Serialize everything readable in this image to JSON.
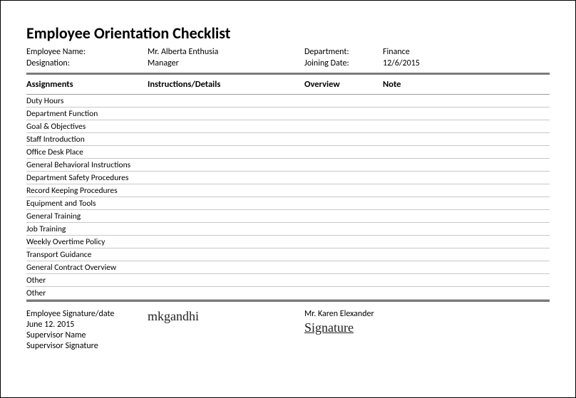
{
  "title": "Employee Orientation Checklist",
  "meta": {
    "employee_name_label": "Employee Name:",
    "employee_name_value": "Mr. Alberta Enthusia",
    "designation_label": "Designation:",
    "designation_value": "Manager",
    "department_label": "Department:",
    "department_value": "Finance",
    "joining_label": "Joining Date:",
    "joining_value": "12/6/2015"
  },
  "columns": {
    "c1": "Assignments",
    "c2": "Instructions/Details",
    "c3": "Overview",
    "c4": "Note"
  },
  "rows": [
    {
      "c1": "Duty Hours",
      "c2": "",
      "c3": "",
      "c4": ""
    },
    {
      "c1": "Department Function",
      "c2": "",
      "c3": "",
      "c4": ""
    },
    {
      "c1": "Goal & Objectives",
      "c2": "",
      "c3": "",
      "c4": ""
    },
    {
      "c1": "Staff Introduction",
      "c2": "",
      "c3": "",
      "c4": ""
    },
    {
      "c1": "Office Desk Place",
      "c2": "",
      "c3": "",
      "c4": ""
    },
    {
      "c1": "General Behavioral Instructions",
      "c2": "",
      "c3": "",
      "c4": ""
    },
    {
      "c1": "Department Safety Procedures",
      "c2": "",
      "c3": "",
      "c4": ""
    },
    {
      "c1": "Record Keeping Procedures",
      "c2": "",
      "c3": "",
      "c4": ""
    },
    {
      "c1": "Equipment and Tools",
      "c2": "",
      "c3": "",
      "c4": ""
    },
    {
      "c1": "General Training",
      "c2": "",
      "c3": "",
      "c4": ""
    },
    {
      "c1": "Job Training",
      "c2": "",
      "c3": "",
      "c4": ""
    },
    {
      "c1": "Weekly Overtime Policy",
      "c2": "",
      "c3": "",
      "c4": ""
    },
    {
      "c1": "Transport Guidance",
      "c2": "",
      "c3": "",
      "c4": ""
    },
    {
      "c1": "General Contract Overview",
      "c2": "",
      "c3": "",
      "c4": ""
    },
    {
      "c1": "Other",
      "c2": "",
      "c3": "",
      "c4": ""
    },
    {
      "c1": "Other",
      "c2": "",
      "c3": "",
      "c4": ""
    }
  ],
  "footer": {
    "emp_sig_label": "Employee Signature/date",
    "emp_sig_date": "June 12. 2015",
    "sup_name_label": "Supervisor Name",
    "sup_sig_label": "Supervisor Signature",
    "sig1_text": "mkgandhi",
    "right_name": "Mr. Karen Elexander",
    "sig2_text": "Signature"
  }
}
